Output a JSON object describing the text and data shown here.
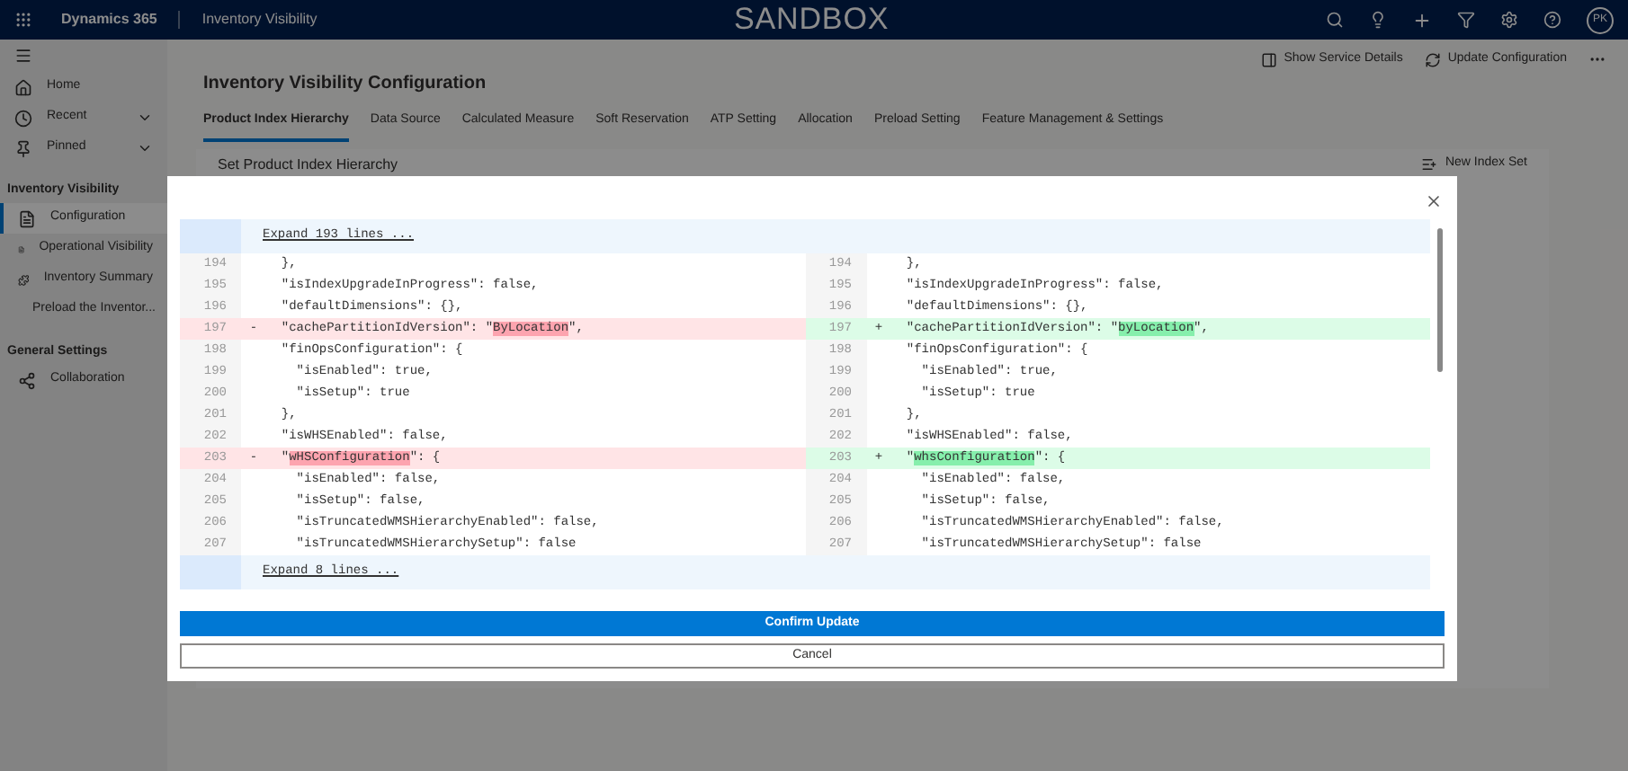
{
  "top_bar": {
    "product": "Dynamics 365",
    "app": "Inventory Visibility",
    "environment": "SANDBOX",
    "avatar": "PK"
  },
  "sidebar": {
    "nav": [
      {
        "label": "Home",
        "expandable": false
      },
      {
        "label": "Recent",
        "expandable": true
      },
      {
        "label": "Pinned",
        "expandable": true
      }
    ],
    "sections": [
      {
        "title": "Inventory Visibility",
        "items": [
          {
            "label": "Configuration",
            "selected": true
          },
          {
            "label": "Operational Visibility",
            "selected": false
          },
          {
            "label": "Inventory Summary",
            "selected": false
          },
          {
            "label": "Preload the Inventor...",
            "selected": false
          }
        ]
      },
      {
        "title": "General Settings",
        "items": [
          {
            "label": "Collaboration",
            "selected": false
          }
        ]
      }
    ]
  },
  "commands": [
    "Show Service Details",
    "Update Configuration"
  ],
  "page_title": "Inventory Visibility Configuration",
  "tabs": [
    {
      "label": "Product Index Hierarchy",
      "selected": true
    },
    {
      "label": "Data Source",
      "selected": false
    },
    {
      "label": "Calculated Measure",
      "selected": false
    },
    {
      "label": "Soft Reservation",
      "selected": false
    },
    {
      "label": "ATP Setting",
      "selected": false
    },
    {
      "label": "Allocation",
      "selected": false
    },
    {
      "label": "Preload Setting",
      "selected": false
    },
    {
      "label": "Feature Management & Settings",
      "selected": false
    }
  ],
  "card": {
    "title": "Set Product Index Hierarchy",
    "action": "New Index Set"
  },
  "dialog": {
    "diff": [
      {
        "kind": "expand",
        "text": "Expand 193 lines ..."
      },
      {
        "kind": "context",
        "left_no": "194",
        "right_no": "194",
        "left_text": "  },",
        "right_text": "  },"
      },
      {
        "kind": "context",
        "left_no": "195",
        "right_no": "195",
        "left_text": "  \"isIndexUpgradeInProgress\": false,",
        "right_text": "  \"isIndexUpgradeInProgress\": false,"
      },
      {
        "kind": "context",
        "left_no": "196",
        "right_no": "196",
        "left_text": "  \"defaultDimensions\": {},",
        "right_text": "  \"defaultDimensions\": {},"
      },
      {
        "kind": "change",
        "left_no": "197",
        "right_no": "197",
        "left_sign": "-",
        "right_sign": "+",
        "left": {
          "before": "  \"cachePartitionIdVersion\": \"",
          "mark": "ByLocation",
          "after": "\","
        },
        "right": {
          "before": "  \"cachePartitionIdVersion\": \"",
          "mark": "byLocation",
          "after": "\","
        }
      },
      {
        "kind": "context",
        "left_no": "198",
        "right_no": "198",
        "left_text": "  \"finOpsConfiguration\": {",
        "right_text": "  \"finOpsConfiguration\": {"
      },
      {
        "kind": "context",
        "left_no": "199",
        "right_no": "199",
        "left_text": "    \"isEnabled\": true,",
        "right_text": "    \"isEnabled\": true,"
      },
      {
        "kind": "context",
        "left_no": "200",
        "right_no": "200",
        "left_text": "    \"isSetup\": true",
        "right_text": "    \"isSetup\": true"
      },
      {
        "kind": "context",
        "left_no": "201",
        "right_no": "201",
        "left_text": "  },",
        "right_text": "  },"
      },
      {
        "kind": "context",
        "left_no": "202",
        "right_no": "202",
        "left_text": "  \"isWHSEnabled\": false,",
        "right_text": "  \"isWHSEnabled\": false,"
      },
      {
        "kind": "change",
        "left_no": "203",
        "right_no": "203",
        "left_sign": "-",
        "right_sign": "+",
        "left": {
          "before": "  \"",
          "mark": "wHSConfiguration",
          "after": "\": {"
        },
        "right": {
          "before": "  \"",
          "mark": "whsConfiguration",
          "after": "\": {"
        }
      },
      {
        "kind": "context",
        "left_no": "204",
        "right_no": "204",
        "left_text": "    \"isEnabled\": false,",
        "right_text": "    \"isEnabled\": false,"
      },
      {
        "kind": "context",
        "left_no": "205",
        "right_no": "205",
        "left_text": "    \"isSetup\": false,",
        "right_text": "    \"isSetup\": false,"
      },
      {
        "kind": "context",
        "left_no": "206",
        "right_no": "206",
        "left_text": "    \"isTruncatedWMSHierarchyEnabled\": false,",
        "right_text": "    \"isTruncatedWMSHierarchyEnabled\": false,"
      },
      {
        "kind": "context",
        "left_no": "207",
        "right_no": "207",
        "left_text": "    \"isTruncatedWMSHierarchySetup\": false",
        "right_text": "    \"isTruncatedWMSHierarchySetup\": false"
      },
      {
        "kind": "expand",
        "text": "Expand 8 lines ..."
      }
    ],
    "confirm": "Confirm Update",
    "cancel": "Cancel"
  }
}
